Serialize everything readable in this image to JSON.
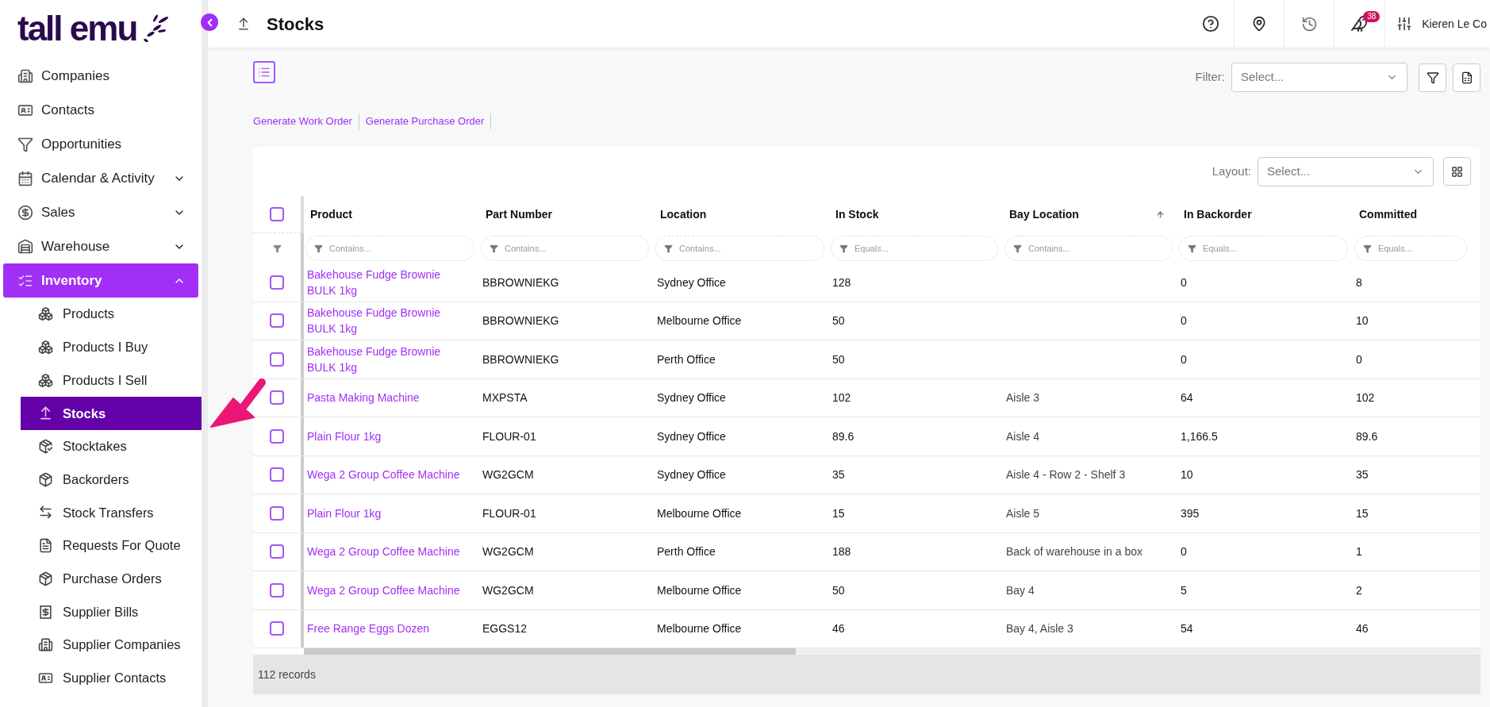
{
  "logo": {
    "text": "tall emu"
  },
  "sidebar": {
    "items": [
      {
        "label": "Companies",
        "selected": false
      },
      {
        "label": "Contacts",
        "selected": false
      },
      {
        "label": "Opportunities",
        "selected": false
      },
      {
        "label": "Calendar & Activity",
        "expandable": true,
        "expanded": false,
        "selected": false
      },
      {
        "label": "Sales",
        "expandable": true,
        "expanded": false,
        "selected": false
      },
      {
        "label": "Warehouse",
        "expandable": true,
        "expanded": false,
        "selected": false
      },
      {
        "label": "Inventory",
        "expandable": true,
        "expanded": true,
        "selected": true,
        "children": [
          {
            "label": "Products",
            "selected": false
          },
          {
            "label": "Products I Buy",
            "selected": false
          },
          {
            "label": "Products I Sell",
            "selected": false
          },
          {
            "label": "Stocks",
            "selected": true
          },
          {
            "label": "Stocktakes",
            "selected": false
          },
          {
            "label": "Backorders",
            "selected": false
          },
          {
            "label": "Stock Transfers",
            "selected": false
          },
          {
            "label": "Requests For Quote",
            "selected": false
          },
          {
            "label": "Purchase Orders",
            "selected": false
          },
          {
            "label": "Supplier Bills",
            "selected": false
          },
          {
            "label": "Supplier Companies",
            "selected": false
          },
          {
            "label": "Supplier Contacts",
            "selected": false
          }
        ]
      }
    ]
  },
  "header": {
    "title": "Stocks",
    "notification_count": "38",
    "user": "Kieren Le Co"
  },
  "actions": [
    "Generate Work Order",
    "Generate Purchase Order"
  ],
  "filter": {
    "label": "Filter:",
    "placeholder": "Select..."
  },
  "layout": {
    "label": "Layout:",
    "placeholder": "Select..."
  },
  "table": {
    "columns": [
      {
        "label": "Product",
        "filter_placeholder": "Contains...",
        "sorted": false
      },
      {
        "label": "Part Number",
        "filter_placeholder": "Contains...",
        "sorted": false
      },
      {
        "label": "Location",
        "filter_placeholder": "Contains...",
        "sorted": false
      },
      {
        "label": "In Stock",
        "filter_placeholder": "Equals...",
        "sorted": false
      },
      {
        "label": "Bay Location",
        "filter_placeholder": "Contains...",
        "sorted": true
      },
      {
        "label": "In Backorder",
        "filter_placeholder": "Equals...",
        "sorted": false
      },
      {
        "label": "Committed",
        "filter_placeholder": "Equals...",
        "sorted": false
      }
    ],
    "select_all_checked": false,
    "rows": [
      {
        "checked": false,
        "cells": [
          "Bakehouse Fudge Brownie BULK 1kg",
          "BBROWNIEKG",
          "Sydney Office",
          "128",
          "",
          "0",
          "8"
        ]
      },
      {
        "checked": false,
        "cells": [
          "Bakehouse Fudge Brownie BULK 1kg",
          "BBROWNIEKG",
          "Melbourne Office",
          "50",
          "",
          "0",
          "10"
        ]
      },
      {
        "checked": false,
        "cells": [
          "Bakehouse Fudge Brownie BULK 1kg",
          "BBROWNIEKG",
          "Perth Office",
          "50",
          "",
          "0",
          "0"
        ]
      },
      {
        "checked": false,
        "cells": [
          "Pasta Making Machine",
          "MXPSTA",
          "Sydney Office",
          "102",
          "Aisle 3",
          "64",
          "102"
        ]
      },
      {
        "checked": false,
        "cells": [
          "Plain Flour 1kg",
          "FLOUR-01",
          "Sydney Office",
          "89.6",
          "Aisle 4",
          "1,166.5",
          "89.6"
        ]
      },
      {
        "checked": false,
        "cells": [
          "Wega 2 Group Coffee Machine",
          "WG2GCM",
          "Sydney Office",
          "35",
          "Aisle 4 - Row 2 - Shelf 3",
          "10",
          "35"
        ]
      },
      {
        "checked": false,
        "cells": [
          "Plain Flour 1kg",
          "FLOUR-01",
          "Melbourne Office",
          "15",
          "Aisle 5",
          "395",
          "15"
        ]
      },
      {
        "checked": false,
        "cells": [
          "Wega 2 Group Coffee Machine",
          "WG2GCM",
          "Perth Office",
          "188",
          "Back of warehouse in a box",
          "0",
          "1"
        ]
      },
      {
        "checked": false,
        "cells": [
          "Wega 2 Group Coffee Machine",
          "WG2GCM",
          "Melbourne Office",
          "50",
          "Bay 4",
          "5",
          "2"
        ]
      },
      {
        "checked": false,
        "cells": [
          "Free Range Eggs Dozen",
          "EGGS12",
          "Melbourne Office",
          "46",
          "Bay 4, Aisle 3",
          "54",
          "46"
        ]
      }
    ],
    "footer": "112 records"
  }
}
